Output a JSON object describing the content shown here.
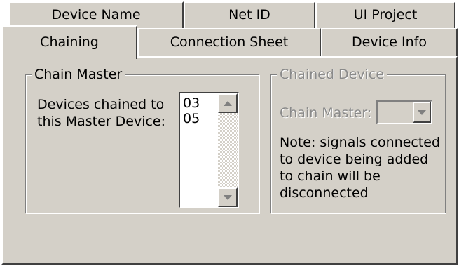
{
  "tabs": {
    "row1": [
      "Device Name",
      "Net ID",
      "UI Project"
    ],
    "row2": [
      "Chaining",
      "Connection Sheet",
      "Device Info"
    ],
    "active": "Chaining"
  },
  "chain_master": {
    "title": "Chain Master",
    "label_line1": "Devices chained to",
    "label_line2": "this Master Device:",
    "devices": [
      "03",
      "05"
    ]
  },
  "chained_device": {
    "title": "Chained Device",
    "enabled": false,
    "chain_master_label": "Chain Master:",
    "chain_master_value": "",
    "note_lines": [
      "Note: signals connected",
      "to device being added",
      "to chain will be",
      "disconnected"
    ]
  },
  "colors": {
    "face": "#d4d0c8",
    "highlight": "#ffffff",
    "shadow": "#808080",
    "dark_shadow": "#404040",
    "disabled_text": "#8a8a8a"
  },
  "icons": {
    "scroll_up": "up-arrow-icon",
    "scroll_down": "down-arrow-icon",
    "combo_dropdown": "down-arrow-icon"
  }
}
